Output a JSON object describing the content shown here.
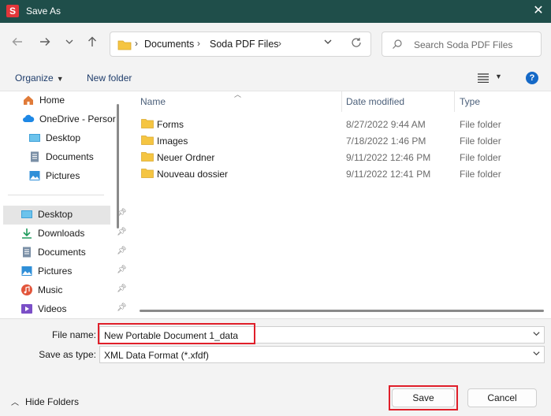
{
  "window": {
    "app_icon_letter": "S",
    "title": "Save As",
    "close_symbol": "✕"
  },
  "navigation": {
    "back_icon": "arrow-left-icon",
    "forward_icon": "arrow-right-icon",
    "recent_icon": "chevron-down-icon",
    "up_icon": "arrow-up-icon",
    "breadcrumb": [
      "Documents",
      "Soda PDF Files"
    ],
    "search_placeholder": "Search Soda PDF Files"
  },
  "toolbar": {
    "organize_label": "Organize",
    "new_folder_label": "New folder",
    "help_label": "?"
  },
  "sidebar": {
    "items": [
      {
        "label": "Home",
        "icon": "home-icon"
      },
      {
        "label": "OneDrive - Persor",
        "icon": "cloud-icon"
      },
      {
        "label": "Desktop",
        "icon": "desktop-icon"
      },
      {
        "label": "Documents",
        "icon": "document-icon"
      },
      {
        "label": "Pictures",
        "icon": "picture-icon"
      }
    ],
    "quick_access": [
      {
        "label": "Desktop",
        "icon": "desktop-icon",
        "pinned": true,
        "selected": true
      },
      {
        "label": "Downloads",
        "icon": "download-icon",
        "pinned": true
      },
      {
        "label": "Documents",
        "icon": "document-icon",
        "pinned": true
      },
      {
        "label": "Pictures",
        "icon": "picture-icon",
        "pinned": true
      },
      {
        "label": "Music",
        "icon": "music-icon",
        "pinned": true
      },
      {
        "label": "Videos",
        "icon": "video-icon",
        "pinned": true
      }
    ]
  },
  "file_list": {
    "columns": [
      "Name",
      "Date modified",
      "Type"
    ],
    "rows": [
      {
        "name": "Forms",
        "date": "8/27/2022 9:44 AM",
        "type": "File folder"
      },
      {
        "name": "Images",
        "date": "7/18/2022 1:46 PM",
        "type": "File folder"
      },
      {
        "name": "Neuer Ordner",
        "date": "9/11/2022 12:46 PM",
        "type": "File folder"
      },
      {
        "name": "Nouveau dossier",
        "date": "9/11/2022 12:41 PM",
        "type": "File folder"
      }
    ]
  },
  "form": {
    "file_name_label": "File name:",
    "file_name_value": "New Portable Document 1_data",
    "save_type_label": "Save as type:",
    "save_type_value": "XML Data Format (*.xfdf)",
    "hide_folders_label": "Hide Folders",
    "save_label": "Save",
    "cancel_label": "Cancel"
  },
  "colors": {
    "titlebar": "#1f4e4a",
    "highlight_box": "#e01f2a",
    "accent_link": "#1f3d6b",
    "folder_yellow": "#f5c542"
  }
}
